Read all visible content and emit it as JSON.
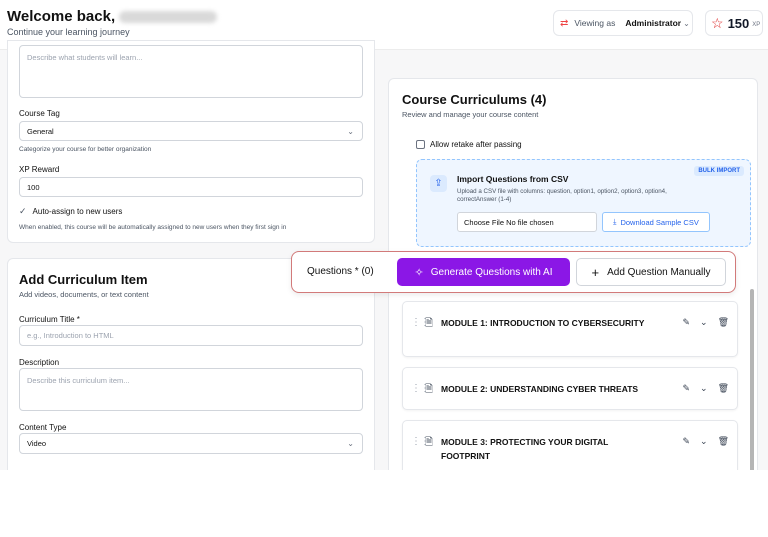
{
  "header": {
    "welcome": "Welcome back,",
    "subtitle": "Continue your learning journey",
    "viewing_label": "Viewing as",
    "viewing_value": "Administrator",
    "xp_value": "150",
    "xp_unit": "XP"
  },
  "form1": {
    "description_placeholder": "Describe what students will learn...",
    "course_tag_label": "Course Tag",
    "course_tag_value": "General",
    "course_tag_hint": "Categorize your course for better organization",
    "xp_reward_label": "XP Reward",
    "xp_reward_value": "100",
    "auto_assign_label": "Auto-assign to new users",
    "auto_assign_hint": "When enabled, this course will be automatically assigned to new users when they first sign in"
  },
  "form2": {
    "title": "Add Curriculum Item",
    "subtitle": "Add videos, documents, or text content",
    "curriculum_title_label": "Curriculum Title *",
    "curriculum_title_placeholder": "e.g., Introduction to HTML",
    "description_label": "Description",
    "description_placeholder": "Describe this curriculum item...",
    "content_type_label": "Content Type",
    "content_type_value": "Video"
  },
  "curriculum": {
    "title": "Course Curriculums (4)",
    "subtitle": "Review and manage your course content",
    "retake_label": "Allow retake after passing",
    "import": {
      "title": "Import Questions from CSV",
      "desc": "Upload a CSV file with columns: question, option1, option2, option3, option4, correctAnswer (1-4)",
      "badge": "BULK IMPORT",
      "file_button": "Choose File",
      "file_status": "No file chosen",
      "download_label": "Download Sample CSV"
    },
    "modules": [
      {
        "title": "MODULE 1: INTRODUCTION TO CYBERSECURITY"
      },
      {
        "title": "MODULE 2: UNDERSTANDING CYBER THREATS"
      },
      {
        "title": "MODULE 3: PROTECTING YOUR DIGITAL FOOTPRINT"
      }
    ]
  },
  "questions_bar": {
    "label": "Questions * (0)",
    "generate_label": "Generate Questions with AI",
    "add_label": "Add Question Manually"
  },
  "colors": {
    "accent_purple": "#8b17e6",
    "link_blue": "#2563eb",
    "star_red": "#dc2626",
    "highlight_border": "#d27a7a"
  },
  "icons": [
    "swap-icon",
    "chevron-down-icon",
    "star-icon",
    "check-icon",
    "upload-icon",
    "download-icon",
    "grip-icon",
    "document-icon",
    "edit-icon",
    "trash-icon",
    "sparkles-icon",
    "plus-icon"
  ]
}
